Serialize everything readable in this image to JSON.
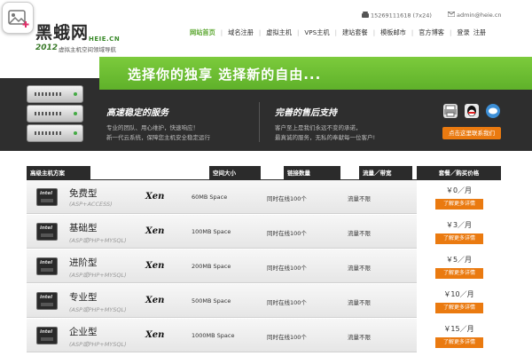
{
  "header": {
    "phone": "15269111618 (7x24)",
    "email": "admin@heie.cn",
    "logo": {
      "name": "黑蛾网",
      "domain": "HEIE.CN",
      "year": "2012",
      "tagline": "虚拟主机空间领域导航"
    }
  },
  "nav": {
    "items": [
      {
        "label": "网站首页",
        "active": true
      },
      {
        "label": "域名注册"
      },
      {
        "label": "虚拟主机"
      },
      {
        "label": "VPS主机"
      },
      {
        "label": "建站套餐"
      },
      {
        "label": "模板邮市"
      },
      {
        "label": "官方博客"
      },
      {
        "label": "登录"
      },
      {
        "label": "注册"
      }
    ]
  },
  "banner": {
    "slogan": "选择你的独享 选择新的自由...",
    "feature1": {
      "title": "高速稳定的服务",
      "line1": "专业的团队、用心维护，快速响应！",
      "line2": "新一代云系统，保障您主机安全稳定运行"
    },
    "feature2": {
      "title": "完善的售后支持",
      "line1": "客户至上是我们永远不变的承诺，",
      "line2": "最真诚的服务，无私的奉献每一位客户!"
    },
    "contact_button": "点击这里联系我们"
  },
  "table": {
    "headers": [
      "高级主机方案",
      "空间大小",
      "链接数量",
      "流量／带宽",
      "套餐／购买价格"
    ],
    "detail_label": "了解更多详情",
    "rows": [
      {
        "name": "免费型",
        "sub": "(ASP+ACCESS)",
        "virt": "Xen",
        "space": "60MB Space",
        "conn": "同时在线100个",
        "flow": "流量不限",
        "price": "￥0／月"
      },
      {
        "name": "基础型",
        "sub": "(ASP或PHP+MYSQL)",
        "virt": "Xen",
        "space": "100MB Space",
        "conn": "同时在线100个",
        "flow": "流量不限",
        "price": "￥3／月"
      },
      {
        "name": "进阶型",
        "sub": "(ASP或PHP+MYSQL)",
        "virt": "Xen",
        "space": "200MB Space",
        "conn": "同时在线100个",
        "flow": "流量不限",
        "price": "￥5／月"
      },
      {
        "name": "专业型",
        "sub": "(ASP或PHP+MYSQL)",
        "virt": "Xen",
        "space": "500MB Space",
        "conn": "同时在线100个",
        "flow": "流量不限",
        "price": "￥10／月"
      },
      {
        "name": "企业型",
        "sub": "(ASP或PHP+MYSQL)",
        "virt": "Xen",
        "space": "1000MB Space",
        "conn": "同时在线100个",
        "flow": "流量不限",
        "price": "￥15／月"
      }
    ]
  },
  "colors": {
    "accent_green": "#5aa62e",
    "orange": "#ea7a10",
    "dark": "#2e2e2e"
  },
  "icons": [
    "gallery-icon",
    "phone-icon",
    "mail-icon",
    "intel-chip-icon",
    "qq-icon"
  ]
}
